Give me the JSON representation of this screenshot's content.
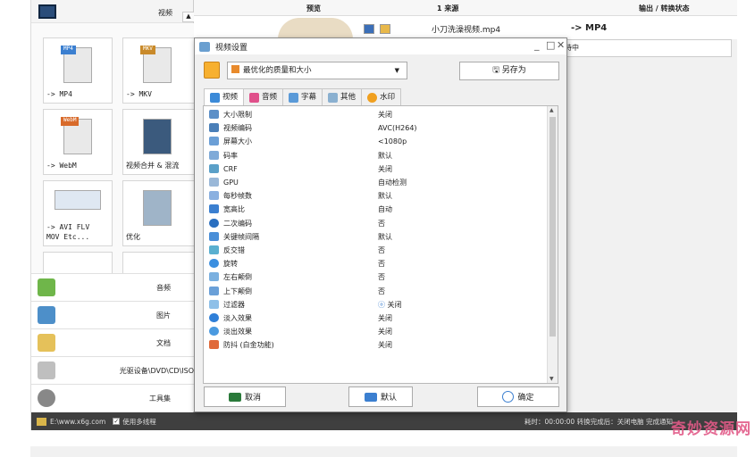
{
  "sidebar": {
    "video_label": "视频",
    "tiles": [
      {
        "tag": "MP4",
        "label": "-> MP4"
      },
      {
        "tag": "MKV",
        "label": "-> MKV"
      },
      {
        "tag": "WebM",
        "label": "-> WebM"
      },
      {
        "tag": "",
        "label": "视频合并 & 混流"
      },
      {
        "tag": "",
        "label": "-> AVI FLV\nMOV Etc..."
      },
      {
        "tag": "",
        "label": "优化"
      }
    ],
    "items": [
      {
        "label": "音频",
        "icon": "music-icon"
      },
      {
        "label": "图片",
        "icon": "picture-icon"
      },
      {
        "label": "文档",
        "icon": "document-icon"
      },
      {
        "label": "光驱设备\\DVD\\CD\\ISO",
        "icon": "disc-icon"
      },
      {
        "label": "工具集",
        "icon": "tools-icon"
      }
    ]
  },
  "table": {
    "headers": {
      "preview": "预览",
      "source": "1 来源",
      "output": "输出 / 转换状态"
    },
    "row": {
      "file": "小刀洗澡视频.mp4",
      "output": "-> MP4",
      "status": "等待中"
    }
  },
  "dialog": {
    "title": "视频设置",
    "quality": "最优化的质量和大小",
    "save_as": "另存为",
    "tabs": [
      "视频",
      "音频",
      "字幕",
      "其他",
      "水印"
    ],
    "rows": [
      {
        "name": "大小限制",
        "value": "关闭"
      },
      {
        "name": "视频编码",
        "value": "AVC(H264)"
      },
      {
        "name": "屏幕大小",
        "value": "<1080p"
      },
      {
        "name": "码率",
        "value": "默认"
      },
      {
        "name": "CRF",
        "value": "关闭"
      },
      {
        "name": "GPU",
        "value": "自动检测"
      },
      {
        "name": "每秒帧数",
        "value": "默认"
      },
      {
        "name": "宽高比",
        "value": "自动"
      },
      {
        "name": "二次编码",
        "value": "否"
      },
      {
        "name": "关键帧间隔",
        "value": "默认"
      },
      {
        "name": "反交错",
        "value": "否"
      },
      {
        "name": "旋转",
        "value": "否"
      },
      {
        "name": "左右颠倒",
        "value": "否"
      },
      {
        "name": "上下颠倒",
        "value": "否"
      },
      {
        "name": "过滤器",
        "value": "关闭"
      },
      {
        "name": "淡入效果",
        "value": "关闭"
      },
      {
        "name": "淡出效果",
        "value": "关闭"
      },
      {
        "name": "防抖 (白金功能)",
        "value": "关闭"
      }
    ],
    "cancel": "取消",
    "default": "默认",
    "ok": "确定"
  },
  "statusbar": {
    "path": "E:\\www.x6g.com",
    "multithread": "使用多线程",
    "right": "耗时：00:00:00  转换完成后：关闭电脑  完成通知"
  },
  "watermark": "奇妙资源网"
}
